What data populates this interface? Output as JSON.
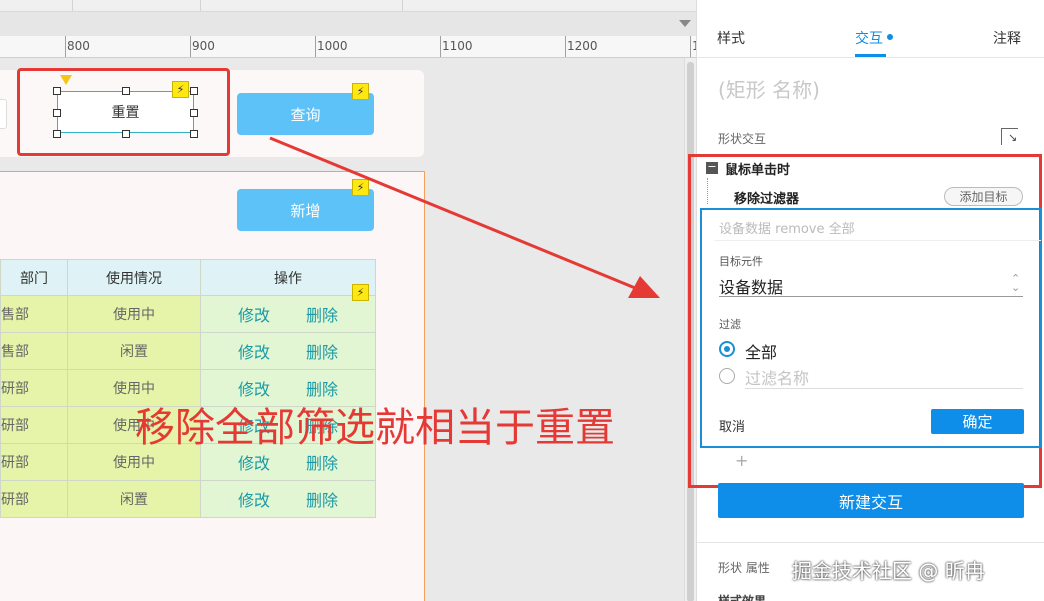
{
  "ruler": {
    "marks": [
      "800",
      "900",
      "1000",
      "1100",
      "1200",
      "1"
    ]
  },
  "canvas": {
    "reset_label": "重置",
    "query_label": "查询",
    "add_label": "新增",
    "table": {
      "headers": [
        "部门",
        "使用情况",
        "操作"
      ],
      "rows": [
        {
          "dept": "售部",
          "status": "使用中"
        },
        {
          "dept": "售部",
          "status": "闲置"
        },
        {
          "dept": "研部",
          "status": "使用中"
        },
        {
          "dept": "研部",
          "status": "使用中"
        },
        {
          "dept": "研部",
          "status": "使用中"
        },
        {
          "dept": "研部",
          "status": "闲置"
        }
      ],
      "edit_label": "修改",
      "delete_label": "删除"
    },
    "caption": "移除全部筛选就相当于重置"
  },
  "panel": {
    "tabs": {
      "style": "样式",
      "interaction": "交互",
      "notes": "注释"
    },
    "shape_name": "(矩形 名称)",
    "shape_interaction": "形状交互",
    "event_label": "鼠标单击时",
    "action_label": "移除过滤器",
    "add_target": "添加目标",
    "action_desc": "设备数据 remove 全部",
    "target_label": "目标元件",
    "target_value": "设备数据",
    "filter_label": "过滤",
    "radio_all": "全部",
    "filter_name_placeholder": "过滤名称",
    "cancel": "取消",
    "ok": "确定",
    "plus": "+",
    "new_interaction": "新建交互",
    "shape_attr": "形状 属性",
    "style_effect": "样式效果"
  },
  "watermark": "掘金技术社区 @ 昕冉",
  "colors": {
    "accent": "#0e8ee8",
    "highlight": "#e53935",
    "button": "#5cc2f7"
  }
}
